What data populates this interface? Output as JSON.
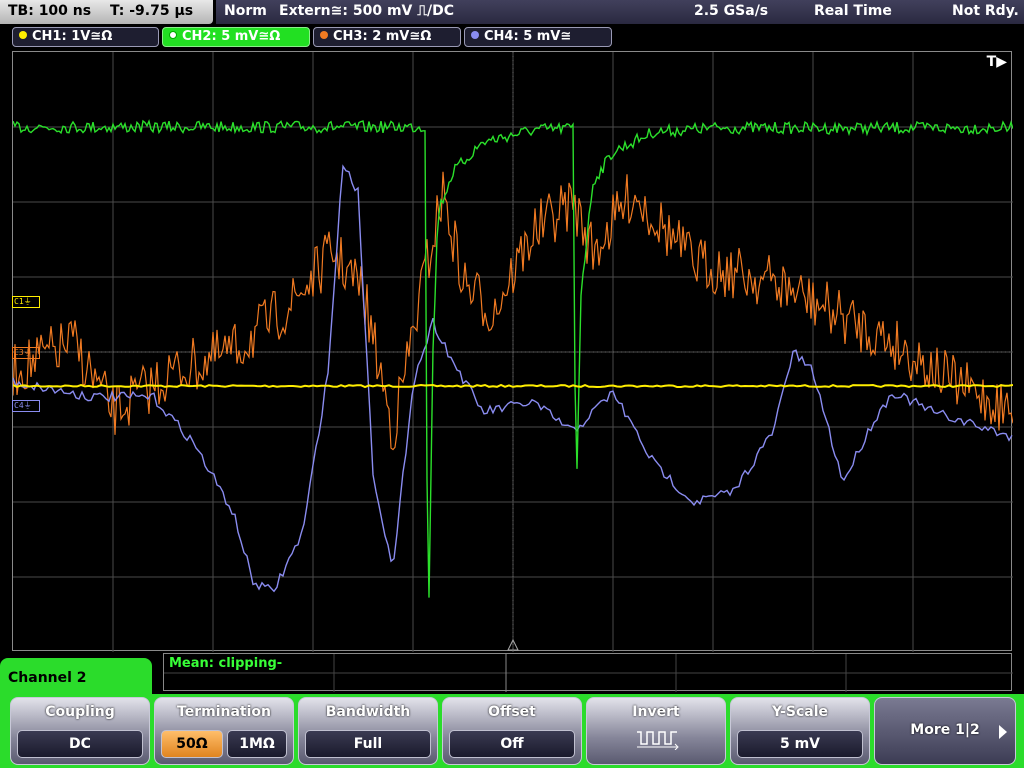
{
  "top_bar": {
    "timebase": "TB: 100 ns",
    "trigger_time": "T: -9.75 µs",
    "trigger_mode": "Norm",
    "trigger_source": "Extern≅: 500 mV ⎍/DC",
    "sample_rate": "2.5 GSa/s",
    "acquisition": "Real Time",
    "status": "Not Rdy."
  },
  "channels": [
    {
      "id": "ch1",
      "label": "CH1: 1V≅Ω",
      "color": "#ffee00",
      "active": false
    },
    {
      "id": "ch2",
      "label": "CH2: 5 mV≅Ω",
      "color": "#2be02b",
      "active": true
    },
    {
      "id": "ch3",
      "label": "CH3: 2 mV≅Ω",
      "color": "#f07a22",
      "active": false
    },
    {
      "id": "ch4",
      "label": "CH4: 5 mV≅",
      "color": "#8a8cf0",
      "active": false
    }
  ],
  "markers": {
    "c1": "C1",
    "c3": "C3",
    "c4": "C4"
  },
  "trigger_marker": "T▶",
  "measurement": {
    "text": "Mean: clipping-"
  },
  "menu": {
    "title": "Channel 2",
    "coupling": {
      "label": "Coupling",
      "value": "DC"
    },
    "termination": {
      "label": "Termination",
      "opt1": "50Ω",
      "opt2": "1MΩ",
      "selected": "50Ω"
    },
    "bandwidth": {
      "label": "Bandwidth",
      "value": "Full"
    },
    "offset": {
      "label": "Offset",
      "value": "Off"
    },
    "invert": {
      "label": "Invert",
      "icon": "inverted-pulse-icon"
    },
    "yscale": {
      "label": "Y-Scale",
      "value": "5 mV"
    },
    "more": {
      "label": "More 1|2"
    }
  },
  "colors": {
    "ch1": "#ffee00",
    "ch2": "#2be02b",
    "ch3": "#f07a22",
    "ch4": "#8a8cf0",
    "menu_green": "#2bdc2b",
    "grid": "#5a5a5a"
  }
}
